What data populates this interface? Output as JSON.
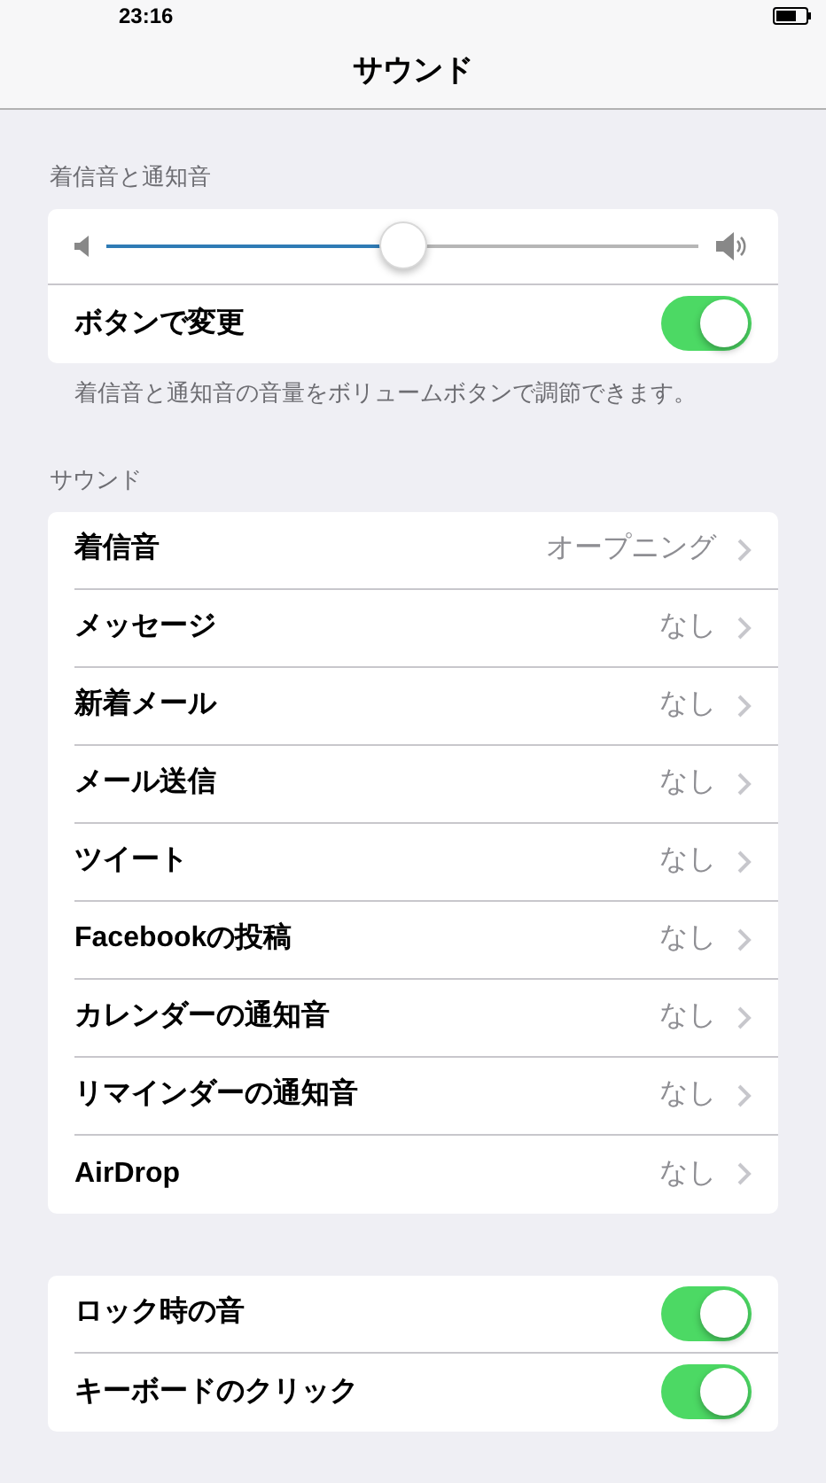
{
  "status_bar": {
    "time": "23:16"
  },
  "nav": {
    "title": "サウンド"
  },
  "ringer_section": {
    "header": "着信音と通知音",
    "volume": {
      "level": 0.5
    },
    "toggle": {
      "label": "ボタンで変更",
      "on": true
    },
    "footer": "着信音と通知音の音量をボリュームボタンで調節できます。"
  },
  "sounds_section": {
    "header": "サウンド",
    "items": [
      {
        "label": "着信音",
        "value": "オープニング"
      },
      {
        "label": "メッセージ",
        "value": "なし"
      },
      {
        "label": "新着メール",
        "value": "なし"
      },
      {
        "label": "メール送信",
        "value": "なし"
      },
      {
        "label": "ツイート",
        "value": "なし"
      },
      {
        "label": "Facebookの投稿",
        "value": "なし"
      },
      {
        "label": "カレンダーの通知音",
        "value": "なし"
      },
      {
        "label": "リマインダーの通知音",
        "value": "なし"
      },
      {
        "label": "AirDrop",
        "value": "なし"
      }
    ]
  },
  "other_toggles": [
    {
      "label": "ロック時の音",
      "on": true
    },
    {
      "label": "キーボードのクリック",
      "on": true
    }
  ]
}
